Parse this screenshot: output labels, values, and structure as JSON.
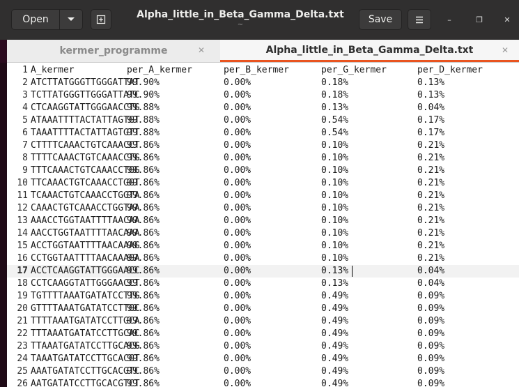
{
  "titlebar": {
    "open_label": "Open",
    "title": "Alpha_little_in_Beta_Gamma_Delta.txt",
    "subtitle": "~",
    "save_label": "Save"
  },
  "tabs": [
    {
      "label": "kermer_programme",
      "active": false
    },
    {
      "label": "Alpha_little_in_Beta_Gamma_Delta.txt",
      "active": true
    }
  ],
  "editor": {
    "current_line": 17,
    "lines": [
      [
        "A_kermer",
        "per_A_kermer",
        "per_B_kermer",
        "per_G_kermer",
        "per_D_kermer"
      ],
      [
        "ATCTTATGGGTTGGGATTAT",
        "99.90%",
        "0.00%",
        "0.18%",
        "0.13%"
      ],
      [
        "TCTTATGGGTTGGGATTATC",
        "99.90%",
        "0.00%",
        "0.18%",
        "0.13%"
      ],
      [
        "CTCAAGGTATTGGGAACCTG",
        "99.88%",
        "0.00%",
        "0.13%",
        "0.04%"
      ],
      [
        "ATAAATTTTACTATTAGTGT",
        "99.88%",
        "0.00%",
        "0.54%",
        "0.17%"
      ],
      [
        "TAAATTTTACTATTAGTGTT",
        "99.88%",
        "0.00%",
        "0.54%",
        "0.17%"
      ],
      [
        "CTTTTCAAACTGTCAAACCT",
        "99.86%",
        "0.00%",
        "0.10%",
        "0.21%"
      ],
      [
        "TTTTCAAACTGTCAAACCTG",
        "99.86%",
        "0.00%",
        "0.10%",
        "0.21%"
      ],
      [
        "TTTCAAACTGTCAAACCTGG",
        "99.86%",
        "0.00%",
        "0.10%",
        "0.21%"
      ],
      [
        "TTCAAACTGTCAAACCTGGT",
        "99.86%",
        "0.00%",
        "0.10%",
        "0.21%"
      ],
      [
        "TCAAACTGTCAAACCTGGTA",
        "99.86%",
        "0.00%",
        "0.10%",
        "0.21%"
      ],
      [
        "CAAACTGTCAAACCTGGTAA",
        "99.86%",
        "0.00%",
        "0.10%",
        "0.21%"
      ],
      [
        "AAACCTGGTAATTTTAACAA",
        "99.86%",
        "0.00%",
        "0.10%",
        "0.21%"
      ],
      [
        "AACCTGGTAATTTTAACAAA",
        "99.86%",
        "0.00%",
        "0.10%",
        "0.21%"
      ],
      [
        "ACCTGGTAATTTTAACAAAG",
        "99.86%",
        "0.00%",
        "0.10%",
        "0.21%"
      ],
      [
        "CCTGGTAATTTTAACAAAGA",
        "99.86%",
        "0.00%",
        "0.10%",
        "0.21%"
      ],
      [
        "ACCTCAAGGTATTGGGAACC",
        "99.86%",
        "0.00%",
        "0.13%",
        "0.04%"
      ],
      [
        "CCTCAAGGTATTGGGAACCT",
        "99.86%",
        "0.00%",
        "0.13%",
        "0.04%"
      ],
      [
        "TGTTTTAAATGATATCCTTG",
        "99.86%",
        "0.00%",
        "0.49%",
        "0.09%"
      ],
      [
        "GTTTTAAATGATATCCTTGC",
        "99.86%",
        "0.00%",
        "0.49%",
        "0.09%"
      ],
      [
        "TTTTAAATGATATCCTTGCA",
        "99.86%",
        "0.00%",
        "0.49%",
        "0.09%"
      ],
      [
        "TTTAAATGATATCCTTGCAC",
        "99.86%",
        "0.00%",
        "0.49%",
        "0.09%"
      ],
      [
        "TTAAATGATATCCTTGCACG",
        "99.86%",
        "0.00%",
        "0.49%",
        "0.09%"
      ],
      [
        "TAAATGATATCCTTGCACGT",
        "99.86%",
        "0.00%",
        "0.49%",
        "0.09%"
      ],
      [
        "AAATGATATCCTTGCACGTC",
        "99.86%",
        "0.00%",
        "0.49%",
        "0.09%"
      ],
      [
        "AATGATATCCTTGCACGTCT",
        "99.86%",
        "0.00%",
        "0.49%",
        "0.09%"
      ]
    ]
  },
  "colors": {
    "accent": "#e95420",
    "titlebar": "#302f2f",
    "tabbar": "#ececec"
  }
}
